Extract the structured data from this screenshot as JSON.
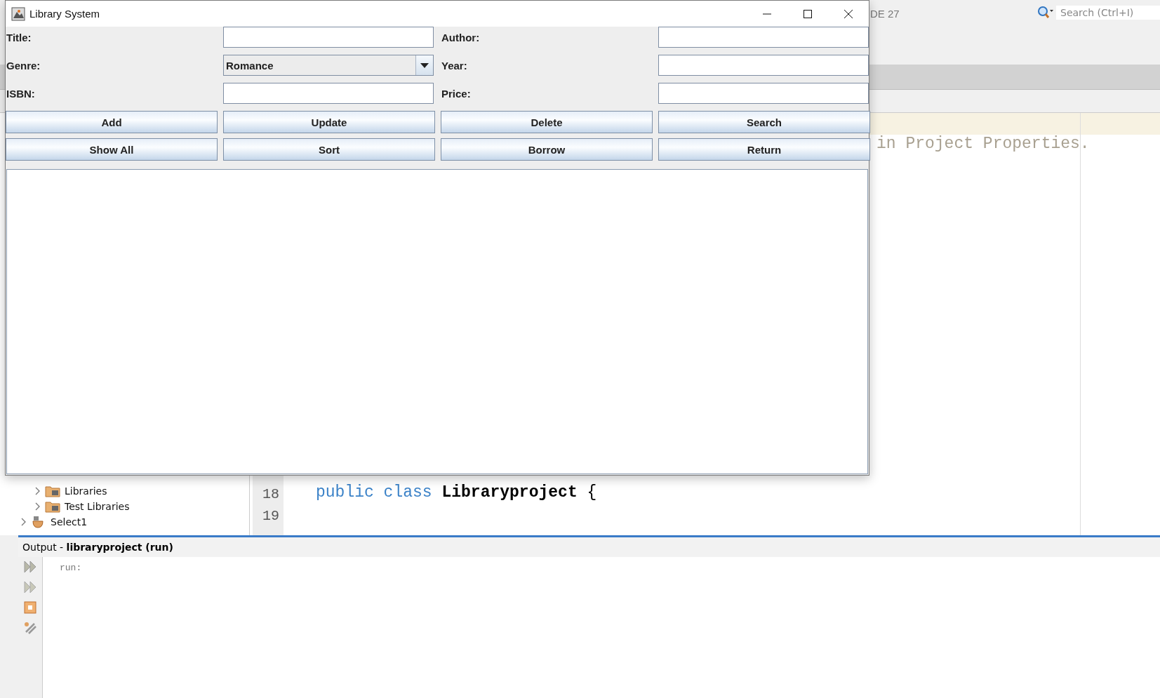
{
  "ide": {
    "toolbar_text": "DE 27",
    "search": {
      "placeholder": "Search (Ctrl+I)"
    },
    "top_code_line": {
      "text": "in Project Properties.",
      "kind": "comment"
    },
    "project_tree": [
      {
        "label": "Libraries",
        "kind": "folder",
        "expanded": false
      },
      {
        "label": "Test Libraries",
        "kind": "folder",
        "expanded": false
      },
      {
        "label": "Select1",
        "kind": "project",
        "expanded": false
      }
    ],
    "code_lines": [
      {
        "number": "18",
        "tokens": [
          {
            "text": "public class",
            "kind": "keyword"
          },
          {
            "text": "Libraryproject",
            "kind": "name"
          },
          {
            "text": "{",
            "kind": "plain"
          }
        ]
      },
      {
        "number": "19"
      }
    ],
    "output": {
      "title": "Output - **libraryproject (run)**",
      "lines": [
        "run:"
      ]
    }
  },
  "app_window": {
    "title": "Library System",
    "fields": [
      {
        "label": "Title:",
        "kind": "text"
      },
      {
        "label": "Author:",
        "kind": "text"
      },
      {
        "label": "Genre:",
        "kind": "combo",
        "value": "Romance"
      },
      {
        "label": "Year:",
        "kind": "text"
      },
      {
        "label": "ISBN:",
        "kind": "text"
      },
      {
        "label": "Price:",
        "kind": "text"
      }
    ],
    "buttons": [
      "Add",
      "Update",
      "Delete",
      "Search",
      "Show All",
      "Sort",
      "Borrow",
      "Return"
    ]
  }
}
